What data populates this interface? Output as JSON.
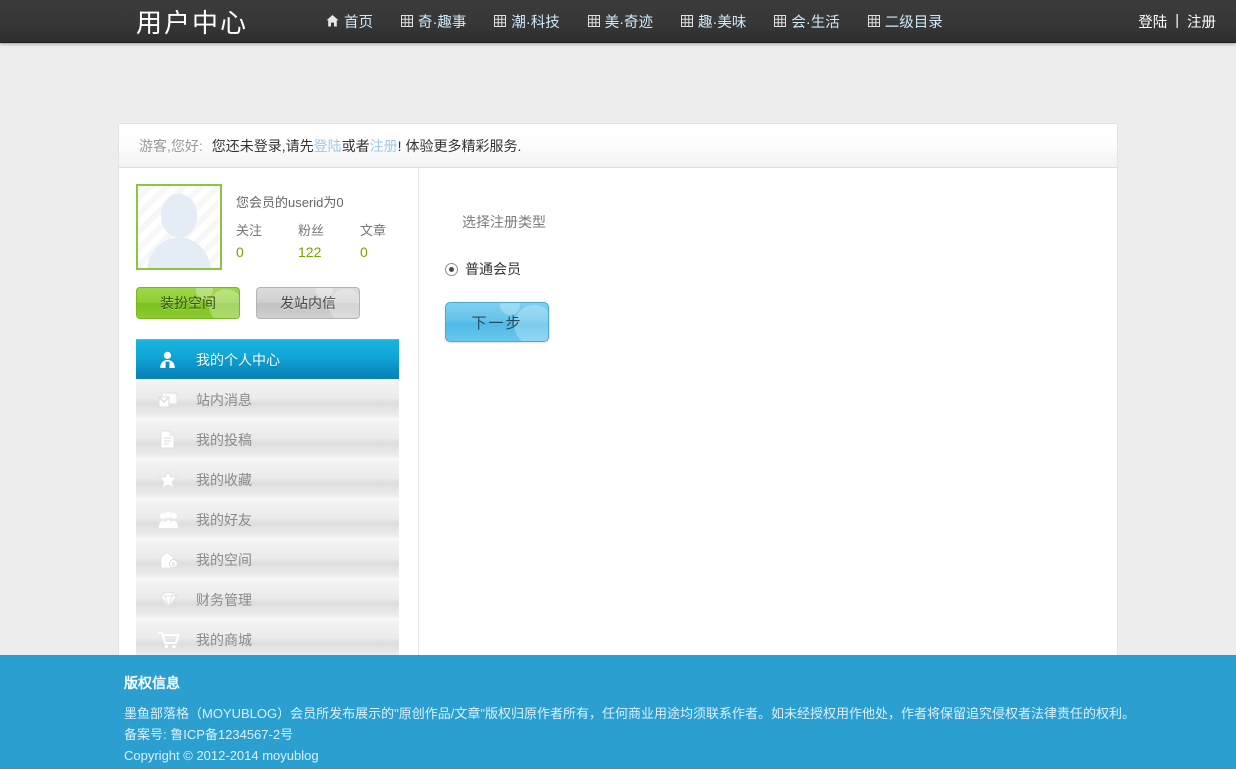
{
  "header": {
    "logo": "用户中心",
    "nav": [
      {
        "icon": "home-icon",
        "label": "首页"
      },
      {
        "icon": "grid-icon",
        "label": "奇·趣事"
      },
      {
        "icon": "grid-icon",
        "label": "潮·科技"
      },
      {
        "icon": "grid-icon",
        "label": "美·奇迹"
      },
      {
        "icon": "grid-icon",
        "label": "趣·美味"
      },
      {
        "icon": "grid-icon",
        "label": "会·生活"
      },
      {
        "icon": "grid-icon",
        "label": "二级目录"
      }
    ],
    "auth": {
      "login": "登陆",
      "separator": "|",
      "register": "注册"
    }
  },
  "notice": {
    "greeting": "游客,您好:",
    "text_before": "您还未登录,请先",
    "login_link": "登陆",
    "between": " 或者 ",
    "register_link": "注册",
    "text_after": "! 体验更多精彩服务."
  },
  "profile": {
    "avatar_name": "default-avatar",
    "userid_line": "您会员的userid为0",
    "stats": [
      {
        "label": "关注",
        "value": "0"
      },
      {
        "label": "粉丝",
        "value": "122"
      },
      {
        "label": "文章",
        "value": "0"
      }
    ],
    "buttons": {
      "decorate": "装扮空间",
      "message": "发站内信"
    }
  },
  "sidebar": {
    "items": [
      {
        "icon": "user-center-icon",
        "label": "我的个人中心",
        "active": true
      },
      {
        "icon": "envelope-icon",
        "label": "站内消息",
        "active": false
      },
      {
        "icon": "document-icon",
        "label": "我的投稿",
        "active": false
      },
      {
        "icon": "star-icon",
        "label": "我的收藏",
        "active": false
      },
      {
        "icon": "people-icon",
        "label": "我的好友",
        "active": false
      },
      {
        "icon": "house-icon",
        "label": "我的空间",
        "active": false
      },
      {
        "icon": "diamond-icon",
        "label": "财务管理",
        "active": false
      },
      {
        "icon": "cart-icon",
        "label": "我的商城",
        "active": false
      }
    ]
  },
  "main": {
    "section_title": "选择注册类型",
    "radio_option": "普通会员",
    "next_button": "下一步"
  },
  "footer": {
    "title": "版权信息",
    "line1": "墨鱼部落格（MOYUBLOG）会员所发布展示的\"原创作品/文章\"版权归原作者所有，任何商业用途均须联系作者。如未经授权用作他处，作者将保留追究侵权者法律责任的权利。",
    "line2": "备案号: 鲁ICP备1234567-2号",
    "line3": "Copyright © 2012-2014 moyublog"
  },
  "colors": {
    "header_bg": "#373737",
    "nav_link": "#cfe9f8",
    "accent_blue": "#10a7d6",
    "footer_bg": "#2b9fd0",
    "green": "#8cc63e",
    "stat_value": "#76a300",
    "next_button": "#5fc1e8"
  }
}
